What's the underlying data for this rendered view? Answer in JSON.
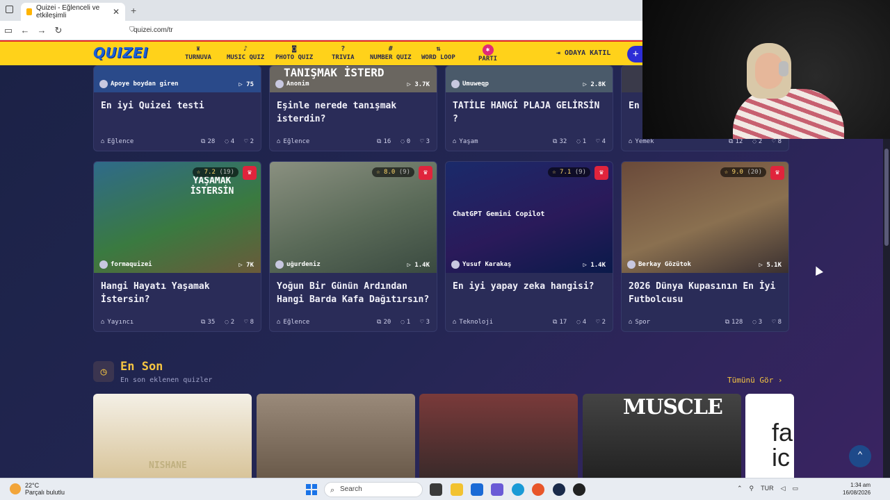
{
  "browser": {
    "tab_title": "Quizei - Eğlenceli ve etkileşimli",
    "tab_close": "✕",
    "new_tab": "+",
    "url": "quizei.com/tr"
  },
  "header": {
    "logo": "QUIZEI",
    "nav": [
      {
        "icon": "♜",
        "label": "TURNUVA"
      },
      {
        "icon": "♪",
        "label": "MUSIC QUIZ"
      },
      {
        "icon": "◙",
        "label": "PHOTO QUIZ"
      },
      {
        "icon": "?",
        "label": "TRIVIA"
      },
      {
        "icon": "#",
        "label": "NUMBER QUIZ"
      },
      {
        "icon": "⇅",
        "label": "WORD LOOP"
      },
      {
        "icon": "✱",
        "label": "PARTI"
      }
    ],
    "join_room": "ODAYA KATIL",
    "plus": "+"
  },
  "top_row": [
    {
      "author": "Apoye boydan giren",
      "plays": "▷ 75",
      "title": "En iyi Quizei testi",
      "category": "Eğlence",
      "questions": "28",
      "comments": "4",
      "likes": "2",
      "thumb": "#2a4a8a",
      "thumb_text": ""
    },
    {
      "author": "Anonim",
      "plays": "▷ 3.7K",
      "title": "Eşinle nerede tanışmak isterdin?",
      "category": "Eğlence",
      "questions": "16",
      "comments": "0",
      "likes": "3",
      "thumb": "#6a6660",
      "thumb_text": "TANIŞMAK İSTERD"
    },
    {
      "author": "Umuweqp",
      "plays": "▷ 2.8K",
      "title": "TATİLE HANGİ PLAJA GELİRSİN ?",
      "category": "Yaşam",
      "questions": "32",
      "comments": "1",
      "likes": "4",
      "thumb": "#4a5a6a",
      "thumb_text": ""
    },
    {
      "author": "",
      "plays": "",
      "title": "En",
      "category": "Yemek",
      "questions": "12",
      "comments": "2",
      "likes": "8",
      "thumb": "#3a3a4a",
      "thumb_text": ""
    }
  ],
  "mid_row": [
    {
      "author": "formaquizei",
      "plays": "▷ 7K",
      "rating": "☆ 7.2",
      "rating_count": "(19)",
      "title": "Hangi Hayatı Yaşamak İstersin?",
      "category": "Yayıncı",
      "questions": "35",
      "comments": "2",
      "likes": "8",
      "thumb": "#3a6a48",
      "thumb_text": "YAŞAMAK İSTERSİN"
    },
    {
      "author": "uğurdeniz",
      "plays": "▷ 1.4K",
      "rating": "☆ 8.0",
      "rating_count": "(9)",
      "title": "Yoğun Bir Günün Ardından Hangi Barda Kafa Dağıtırsın?",
      "category": "Eğlence",
      "questions": "20",
      "comments": "1",
      "likes": "3",
      "thumb": "#6e7a68",
      "thumb_text": ""
    },
    {
      "author": "Yusuf Karakaş",
      "plays": "▷ 1.4K",
      "rating": "☆ 7.1",
      "rating_count": "(9)",
      "title": "En iyi yapay zeka hangisi?",
      "category": "Teknoloji",
      "questions": "17",
      "comments": "4",
      "likes": "2",
      "thumb": "#1a1e5a",
      "thumb_text": "ChatGPT  Gemini  Copilot"
    },
    {
      "author": "Berkay Gözütok",
      "plays": "▷ 5.1K",
      "rating": "☆ 9.0",
      "rating_count": "(20)",
      "title": "2026 Dünya Kupasının En İyi Futbolcusu",
      "category": "Spor",
      "questions": "128",
      "comments": "3",
      "likes": "8",
      "thumb": "#5a4a3a",
      "thumb_text": ""
    }
  ],
  "latest": {
    "title": "En Son",
    "subtitle": "En son eklenen quizler",
    "see_all": "Tümünü Gör ›",
    "thumbs": [
      {
        "color": "#e8d6b0",
        "text": "NISHANE"
      },
      {
        "color": "#8a7a6a",
        "text": ""
      },
      {
        "color": "#6a3a3a",
        "text": ""
      },
      {
        "color": "#2a2a2a",
        "text": "MUSCLE"
      },
      {
        "color": "#ffffff",
        "text": "fa ic"
      }
    ]
  },
  "taskbar": {
    "temp": "22°C",
    "weather": "Parçalı bulutlu",
    "search": "Search",
    "lang": "TUR",
    "time": "1:34 am",
    "date": "16/08/2026"
  }
}
